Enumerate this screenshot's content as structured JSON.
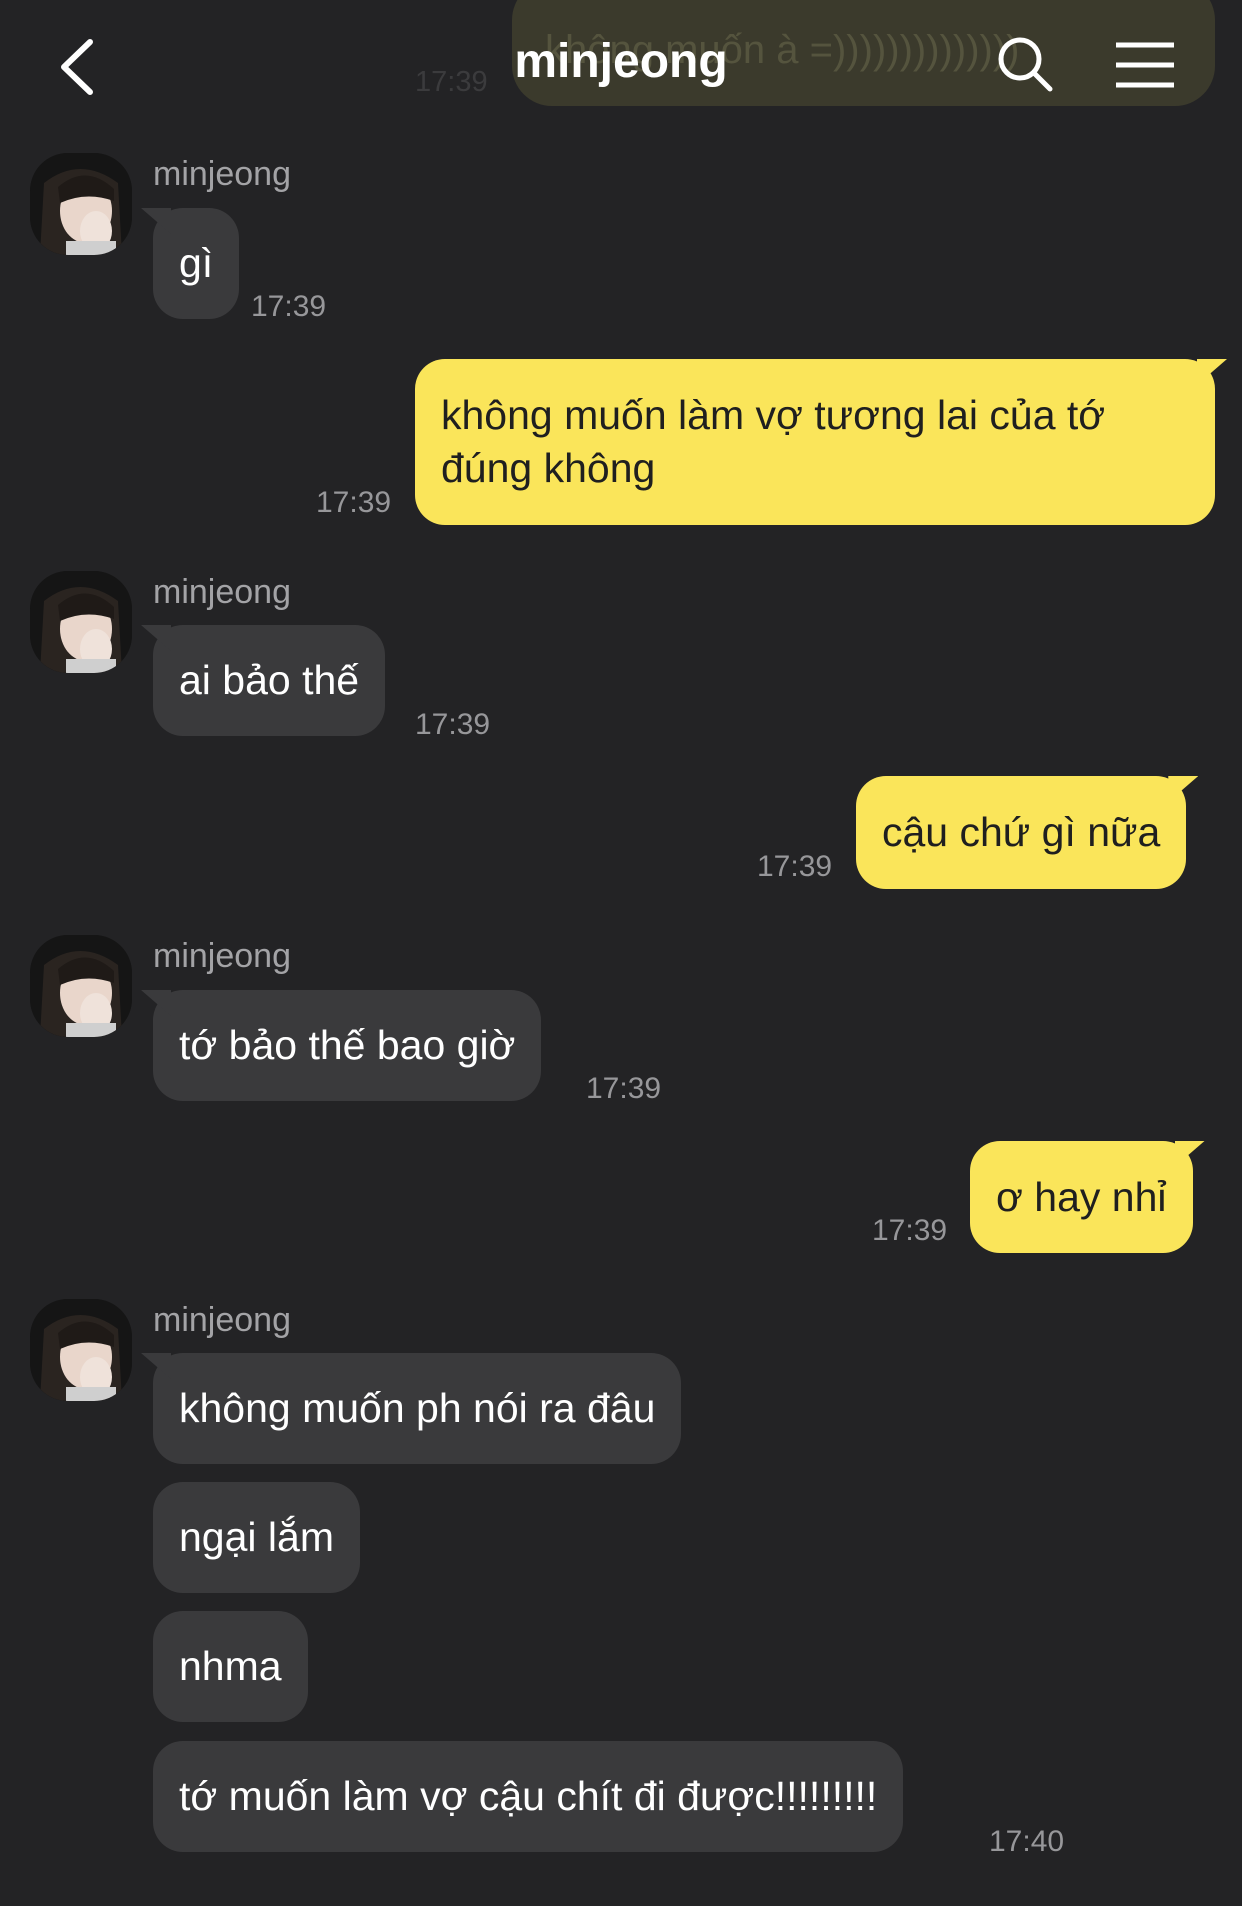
{
  "header": {
    "title": "minjeong",
    "ghost_message": "không muốn à =))))))))))))))",
    "ghost_time": "17:39",
    "back_icon": "back-chevron-icon",
    "search_icon": "search-icon",
    "menu_icon": "hamburger-menu-icon"
  },
  "colors": {
    "background": "#232325",
    "incoming_bubble": "#3a3a3c",
    "outgoing_bubble": "#fae55a",
    "timestamp": "#97979a"
  },
  "messages": [
    {
      "sender": "minjeong",
      "text": "gì",
      "time": "17:39"
    },
    {
      "sender": "me",
      "text_line1": "không muốn làm vợ tương lai của tớ",
      "text_line2": "đúng không",
      "time": "17:39"
    },
    {
      "sender": "minjeong",
      "text": "ai bảo thế",
      "time": "17:39"
    },
    {
      "sender": "me",
      "text": "cậu chứ gì nữa",
      "time": "17:39"
    },
    {
      "sender": "minjeong",
      "text": "tớ bảo thế bao giờ",
      "time": "17:39"
    },
    {
      "sender": "me",
      "text": "ơ hay nhỉ",
      "time": "17:39"
    },
    {
      "sender": "minjeong",
      "text": "không muốn ph nói ra đâu"
    },
    {
      "sender": "minjeong",
      "text": "ngại lắm"
    },
    {
      "sender": "minjeong",
      "text": "nhma"
    },
    {
      "sender": "minjeong",
      "text": "tớ muốn làm vợ cậu chít đi được!!!!!!!!!",
      "time": "17:40"
    }
  ]
}
